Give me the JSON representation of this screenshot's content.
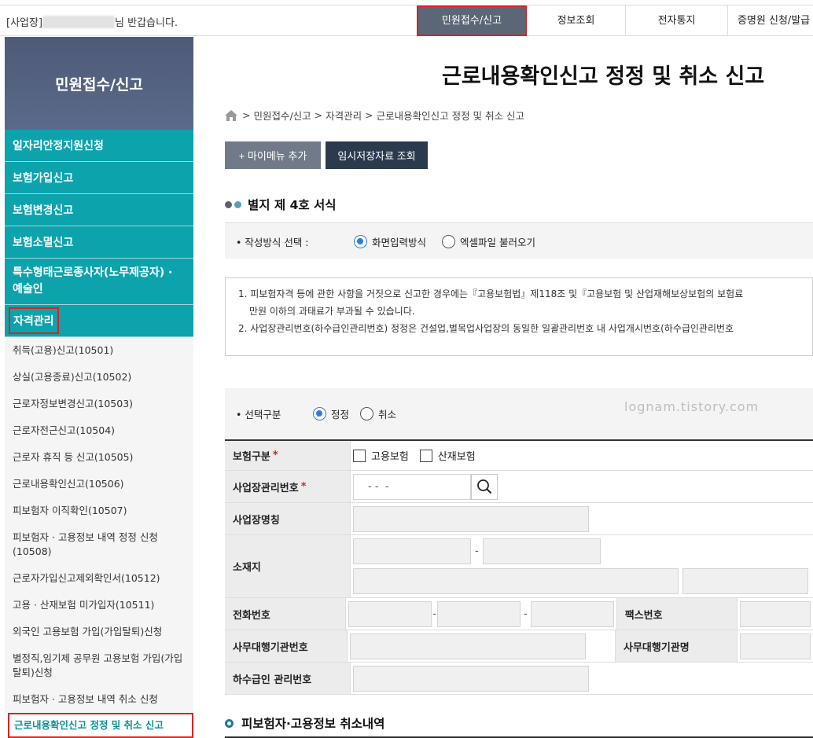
{
  "topbar": {
    "greeting_prefix": "[사업장]",
    "greeting_suffix": "님 반갑습니다.",
    "nav": [
      {
        "label": "민원접수/신고",
        "active": true
      },
      {
        "label": "정보조회",
        "active": false
      },
      {
        "label": "전자통지",
        "active": false
      },
      {
        "label": "증명원 신청/발급",
        "active": false
      }
    ]
  },
  "sidebar": {
    "title": "민원접수/신고",
    "groups": [
      "일자리안정지원신청",
      "보험가입신고",
      "보험변경신고",
      "보험소멸신고",
      "특수형태근로종사자(노무제공자) · 예술인",
      "자격관리"
    ],
    "sub_items": [
      "취득(고용)신고(10501)",
      "상실(고용종료)신고(10502)",
      "근로자정보변경신고(10503)",
      "근로자전근신고(10504)",
      "근로자 휴직 등 신고(10505)",
      "근로내용확인신고(10506)",
      "피보험자 이직확인(10507)",
      "피보험자 · 고용정보 내역 정정 신청(10508)",
      "근로자가입신고제외확인서(10512)",
      "고용 · 산재보험 미가입자(10511)",
      "외국인 고용보험 가입(가입탈퇴)신청",
      "별정직,임기제 공무원 고용보험 가입(가입탈퇴)신청",
      "피보험자 · 고용정보 내역 취소 신청",
      "근로내용확인신고 정정 및 취소 신고"
    ]
  },
  "main": {
    "title": "근로내용확인신고 정정 및 취소 신고",
    "breadcrumb": [
      "민원접수/신고",
      "자격관리",
      "근로내용확인신고 정정 및 취소 신고"
    ],
    "breadcrumb_sep": ">",
    "buttons": {
      "add_menu": "+ 마이메뉴 추가",
      "temp_view": "임시저장자료 조회"
    },
    "form_section_title": "별지 제 4호 서식",
    "method": {
      "label": "• 작성방식 선택 :",
      "options": [
        {
          "label": "화면입력방식",
          "selected": true
        },
        {
          "label": "엑셀파일 불러오기",
          "selected": false
        }
      ]
    },
    "notice": [
      "1. 피보험자격 등에 관한 사항을 거짓으로 신고한 경우에는『고용보험법』제118조 및『고용보험 및 산업재해보상보험의 보험료",
      "만원 이하의 과태료가 부과될 수 있습니다.",
      "2. 사업장관리번호(하수급인관리번호) 정정은 건설업,벌목업사업장의 동일한 일괄관리번호 내 사업개시번호(하수급인관리번호"
    ],
    "selection": {
      "label": "• 선택구분",
      "options": [
        {
          "label": "정정",
          "selected": true
        },
        {
          "label": "취소",
          "selected": false
        }
      ]
    },
    "watermark": "lognam.tistory.com",
    "fields": {
      "insurance_type": "보험구분",
      "insurance_opts": [
        "고용보험",
        "산재보험"
      ],
      "biz_no": "사업장관리번호",
      "biz_no_value": "- -  -",
      "biz_name": "사업장명칭",
      "address": "소재지",
      "address_dash": "-",
      "phone": "전화번호",
      "phone_dash": "-",
      "fax": "팩스번호",
      "agency_no": "사무대행기관번호",
      "agency_name": "사무대행기관명",
      "sub_no": "하수급인 관리번호",
      "required_mark": "*"
    },
    "cancel_section_title": "피보험자·고용정보 취소내역"
  },
  "colors": {
    "teal": "#0ca3ad",
    "active_nav": "#5b6776",
    "highlight": "#e02020",
    "radio": "#2b7fd9"
  }
}
